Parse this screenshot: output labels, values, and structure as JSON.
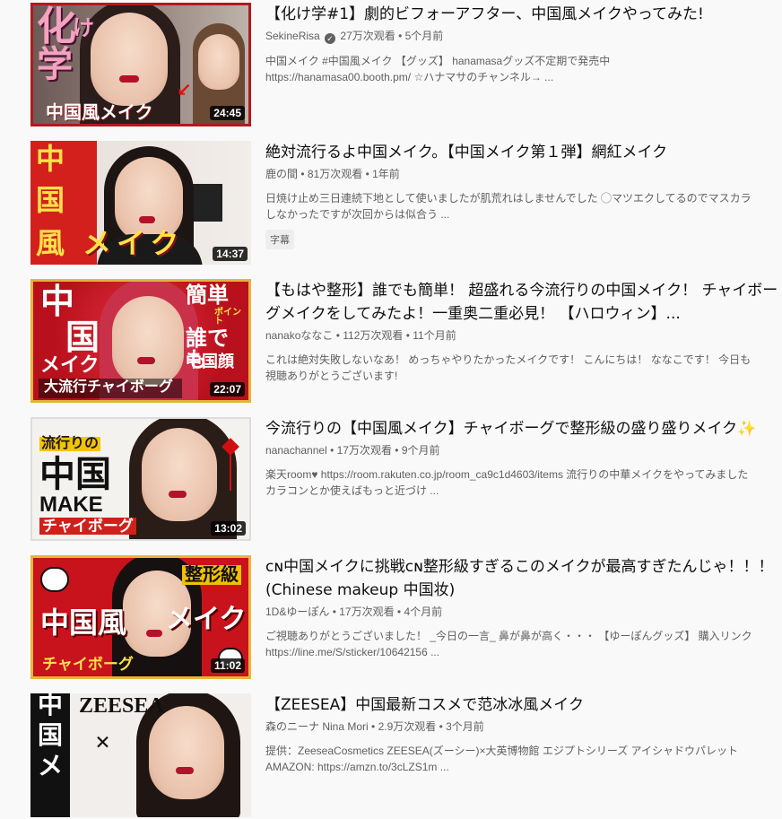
{
  "videos": [
    {
      "title": "【化け学#1】劇的ビフォーアフター、中国風メイクやってみた!",
      "channel": "SekineRisa",
      "verified": true,
      "views": "27万次观看",
      "age": "5个月前",
      "desc_lines": [
        "中国メイク #中国風メイク 【グッズ】 hanamasaグッズ不定期で発売中",
        "https://hanamasa00.booth.pm/ ☆ハナマサのチャンネル→ ..."
      ],
      "duration": "24:45",
      "thumb_text": [
        "化",
        "け",
        "学",
        "中国風メイク"
      ]
    },
    {
      "title": "絶対流行るよ中国メイク。【中国メイク第１弾】網紅メイク",
      "channel": "鹿の間",
      "verified": false,
      "views": "81万次观看",
      "age": "1年前",
      "desc_lines": [
        "日焼け止め三日連続下地として使いましたが肌荒れはしませんでした ◯マツエクしてるのでマスカラ",
        "しなかったですが次回からは似合う ..."
      ],
      "badge": "字幕",
      "duration": "14:37",
      "thumb_text": [
        "中",
        "国",
        "風",
        "メイク"
      ]
    },
    {
      "title": "【もはや整形】誰でも簡単！ 超盛れる今流行りの中国メイク！ チャイボーグメイクをしてみたよ！一重奥二重必見！ 【ハロウィン】...",
      "channel": "nanakoななこ",
      "verified": false,
      "views": "112万次观看",
      "age": "11个月前",
      "desc_lines": [
        "これは絶対失敗しないなあ！ めっちゃやりたかったメイクです！ こんにちは！ ななこです！ 今日も",
        "視聴ありがとうございます!"
      ],
      "duration": "22:07",
      "thumb_text": [
        "中",
        "国",
        "メイク",
        "簡単",
        "ポイント",
        "誰でも",
        "中国顔",
        "大流行チャイボーグ"
      ]
    },
    {
      "title": "今流行りの【中国風メイク】チャイボーグで整形級の盛り盛りメイク✨",
      "channel": "nanachannel",
      "verified": false,
      "views": "17万次观看",
      "age": "9个月前",
      "desc_lines": [
        "楽天room♥ https://room.rakuten.co.jp/room_ca9c1d4603/items 流行りの中華メイクをやってみました",
        "カラコンとか使えばもっと近づけ ..."
      ],
      "duration": "13:02",
      "thumb_text": [
        "流行りの",
        "中国",
        "MAKE",
        "チャイボーグ"
      ]
    },
    {
      "title": "ᴄɴ中国メイクに挑戦ᴄɴ整形級すぎるこのメイクが最高すぎたんじゃ！！！ (Chinese makeup 中国妆)",
      "channel": "1D&ゆーぽん",
      "verified": false,
      "views": "17万次观看",
      "age": "4个月前",
      "desc_lines": [
        "ご視聴ありがとうございました！ _今日の一言_ 鼻が鼻が高く・・・ 【ゆーぽんグッズ】 購入リンク",
        "https://line.me/S/sticker/10642156 ..."
      ],
      "duration": "11:02",
      "thumb_text": [
        "整形級",
        "中国風",
        "メイク",
        "チャイボーグ"
      ]
    },
    {
      "title": "【ZEESEA】中国最新コスメで范冰冰風メイク",
      "channel": "森のニーナ Nina Mori",
      "verified": false,
      "views": "2.9万次观看",
      "age": "3个月前",
      "desc_lines": [
        "提供：ZeeseaCosmetics ZEESEA(ズーシー)×大英博物館 エジプトシリーズ アイシャドウパレット",
        "AMAZON: https://amzn.to/3cLZS1m ..."
      ],
      "duration": "",
      "thumb_text": [
        "中",
        "国",
        "メ",
        "ZEESEA",
        "×"
      ]
    }
  ],
  "colors": {
    "accent_red": "#c4121f",
    "gold": "#f0c020"
  }
}
